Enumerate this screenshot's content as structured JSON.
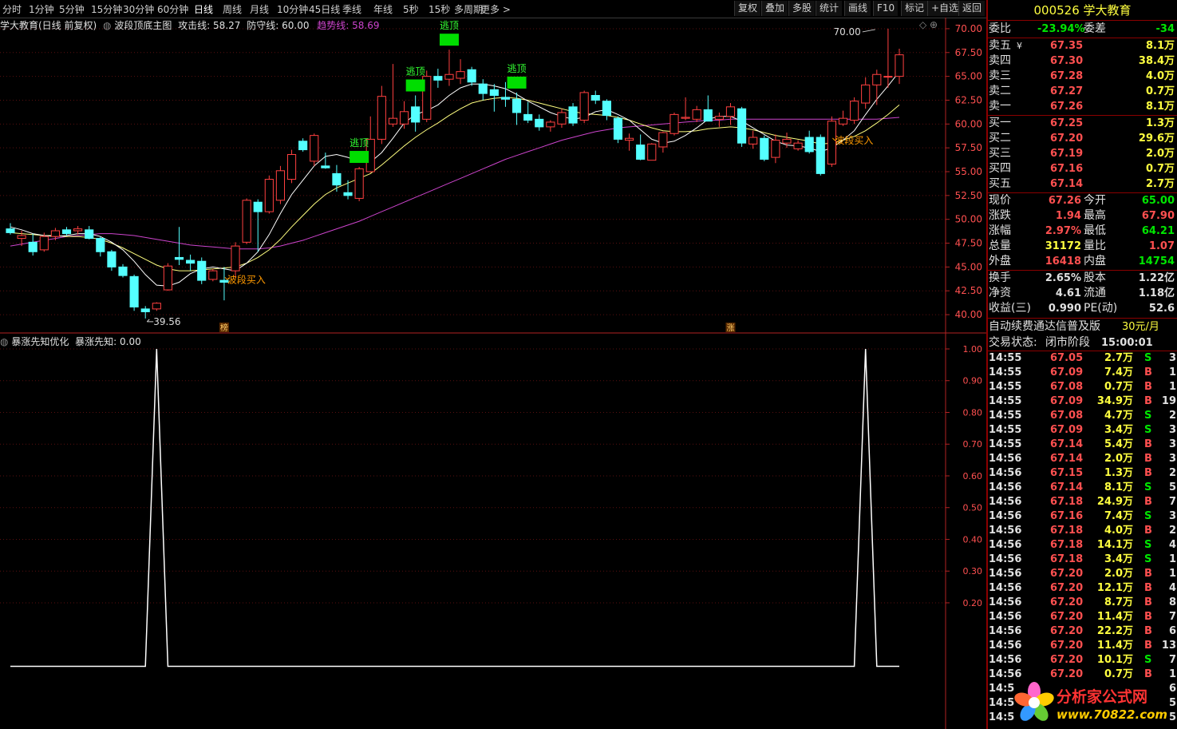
{
  "toolbar": {
    "periods": [
      "分时",
      "1分钟",
      "5分钟",
      "15分钟",
      "30分钟",
      "60分钟",
      "日线",
      "周线",
      "月线",
      "10分钟",
      "45日线",
      "季线",
      "年线",
      "5秒",
      "15秒",
      "多周期",
      "更多 >"
    ],
    "right": [
      "复权",
      "叠加",
      "多股",
      "统计",
      "画线",
      "F10",
      "标记",
      "+自选",
      "返回"
    ]
  },
  "main_info": {
    "stock": "学大教育(日线 前复权)",
    "indicator": "波段顶底主图",
    "attack_label": "攻击线:",
    "attack": "58.27",
    "defense_label": "防守线:",
    "defense": "60.00",
    "trend_label": "趋势线:",
    "trend": "58.69"
  },
  "sub_info": {
    "indicator": "暴涨先知优化",
    "value_label": "暴涨先知:",
    "value": "0.00"
  },
  "markers": {
    "escape": "逃顶",
    "buy": "波段买入",
    "high": "70.00",
    "low": "39.56",
    "bang": "榜",
    "zhang": "涨"
  },
  "colors": {
    "up": "#ff4040",
    "down": "#54ffff",
    "ma_fast": "#ffffff",
    "ma_slow": "#ffff80",
    "ma_trend": "#cc44cc",
    "escape": "#00dd00",
    "buy": "#ff9900",
    "axis": "#b22222"
  },
  "chart_data": [
    {
      "type": "candlestick",
      "title": "学大教育(日线 前复权)",
      "y_ticks": [
        40.0,
        42.5,
        45.0,
        47.5,
        50.0,
        52.5,
        55.0,
        57.5,
        60.0,
        62.5,
        65.0,
        67.5,
        70.0
      ],
      "ylim": [
        39.0,
        71.0
      ],
      "ohlc": [
        [
          49.0,
          49.6,
          48.4,
          48.6
        ],
        [
          48.0,
          48.8,
          47.2,
          48.3
        ],
        [
          47.6,
          48.5,
          46.2,
          46.6
        ],
        [
          46.8,
          48.6,
          46.6,
          48.2
        ],
        [
          48.2,
          49.1,
          47.8,
          48.8
        ],
        [
          48.9,
          49.2,
          48.3,
          48.5
        ],
        [
          48.8,
          49.3,
          48.4,
          49.0
        ],
        [
          48.9,
          49.3,
          47.9,
          48.0
        ],
        [
          48.0,
          48.2,
          46.1,
          46.6
        ],
        [
          46.6,
          46.8,
          44.6,
          45.0
        ],
        [
          45.0,
          45.3,
          43.9,
          44.1
        ],
        [
          44.0,
          44.2,
          40.4,
          40.8
        ],
        [
          40.6,
          40.9,
          39.6,
          40.3
        ],
        [
          40.6,
          41.3,
          40.4,
          41.2
        ],
        [
          42.6,
          45.4,
          42.5,
          45.1
        ],
        [
          46.0,
          49.2,
          45.2,
          45.8
        ],
        [
          45.7,
          46.3,
          44.6,
          45.4
        ],
        [
          45.6,
          46.0,
          43.2,
          43.6
        ],
        [
          43.7,
          44.8,
          43.5,
          44.6
        ],
        [
          43.6,
          45.0,
          41.5,
          43.4
        ],
        [
          44.6,
          47.6,
          43.8,
          47.2
        ],
        [
          47.6,
          52.2,
          47.4,
          52.0
        ],
        [
          51.8,
          52.1,
          46.6,
          50.8
        ],
        [
          50.8,
          54.6,
          50.6,
          54.2
        ],
        [
          52.0,
          55.6,
          51.6,
          55.1
        ],
        [
          54.2,
          57.3,
          53.8,
          56.8
        ],
        [
          58.2,
          58.5,
          57.1,
          57.3
        ],
        [
          56.1,
          59.0,
          55.6,
          58.8
        ],
        [
          55.6,
          57.0,
          55.3,
          55.4
        ],
        [
          54.8,
          55.7,
          52.9,
          53.6
        ],
        [
          52.8,
          54.1,
          52.1,
          52.5
        ],
        [
          52.2,
          55.5,
          51.9,
          55.3
        ],
        [
          55.0,
          60.8,
          54.9,
          58.4
        ],
        [
          58.4,
          64.0,
          57.9,
          62.9
        ],
        [
          60.0,
          66.3,
          59.7,
          60.6
        ],
        [
          60.0,
          62.4,
          59.5,
          61.3
        ],
        [
          61.8,
          63.0,
          59.2,
          60.2
        ],
        [
          60.5,
          65.6,
          60.2,
          65.0
        ],
        [
          65.0,
          65.8,
          63.8,
          64.6
        ],
        [
          64.7,
          67.8,
          64.0,
          65.2
        ],
        [
          64.8,
          66.8,
          64.2,
          65.5
        ],
        [
          65.7,
          66.0,
          64.0,
          64.4
        ],
        [
          64.2,
          64.7,
          62.5,
          63.2
        ],
        [
          63.6,
          64.2,
          61.3,
          63.0
        ],
        [
          62.8,
          64.4,
          61.8,
          62.6
        ],
        [
          62.6,
          63.3,
          59.9,
          61.2
        ],
        [
          61.0,
          62.3,
          60.1,
          60.4
        ],
        [
          60.5,
          61.0,
          59.3,
          59.7
        ],
        [
          59.7,
          60.4,
          59.2,
          60.2
        ],
        [
          60.0,
          61.6,
          59.6,
          61.2
        ],
        [
          61.8,
          62.2,
          59.8,
          60.1
        ],
        [
          60.4,
          63.5,
          60.1,
          63.3
        ],
        [
          63.0,
          63.5,
          62.1,
          62.5
        ],
        [
          62.4,
          62.6,
          60.4,
          60.9
        ],
        [
          60.6,
          60.8,
          58.0,
          58.4
        ],
        [
          58.3,
          59.0,
          57.2,
          58.5
        ],
        [
          57.8,
          58.9,
          56.2,
          56.3
        ],
        [
          56.2,
          58.0,
          56.2,
          57.9
        ],
        [
          57.6,
          59.2,
          57.0,
          59.1
        ],
        [
          59.0,
          61.2,
          58.8,
          61.0
        ],
        [
          60.6,
          62.8,
          60.4,
          60.7
        ],
        [
          60.5,
          61.9,
          60.2,
          61.5
        ],
        [
          61.5,
          63.0,
          60.4,
          60.3
        ],
        [
          60.5,
          61.2,
          59.7,
          60.8
        ],
        [
          60.8,
          62.2,
          59.9,
          61.8
        ],
        [
          61.6,
          61.8,
          57.6,
          58.0
        ],
        [
          57.9,
          59.3,
          57.4,
          58.6
        ],
        [
          58.5,
          58.8,
          56.1,
          56.3
        ],
        [
          56.5,
          58.9,
          55.9,
          58.3
        ],
        [
          58.0,
          59.1,
          57.5,
          58.4
        ],
        [
          57.4,
          58.3,
          57.2,
          58.0
        ],
        [
          58.6,
          59.3,
          56.9,
          57.1
        ],
        [
          58.6,
          58.9,
          54.6,
          54.8
        ],
        [
          55.8,
          60.8,
          55.5,
          60.3
        ],
        [
          60.0,
          61.4,
          59.8,
          60.6
        ],
        [
          60.4,
          62.8,
          60.0,
          62.4
        ],
        [
          62.2,
          64.9,
          61.6,
          64.1
        ],
        [
          64.1,
          65.7,
          62.0,
          65.2
        ],
        [
          65.0,
          70.0,
          63.8,
          65.0
        ],
        [
          65.0,
          67.9,
          64.2,
          67.26
        ]
      ],
      "ma_fast": [
        49.2,
        48.9,
        48.5,
        48.3,
        48.2,
        48.3,
        48.5,
        48.5,
        48.2,
        47.6,
        46.8,
        45.6,
        44.2,
        43.1,
        43.0,
        43.4,
        44.3,
        44.8,
        45.0,
        44.8,
        44.6,
        45.4,
        46.6,
        48.4,
        50.6,
        52.6,
        54.1,
        55.6,
        56.6,
        56.8,
        56.5,
        56.0,
        56.0,
        57.0,
        58.5,
        60.1,
        61.0,
        61.4,
        62.0,
        63.0,
        63.8,
        64.2,
        64.2,
        64.0,
        63.7,
        63.1,
        62.4,
        61.8,
        61.2,
        60.8,
        60.5,
        60.7,
        61.3,
        61.5,
        61.0,
        60.4,
        59.4,
        58.4,
        58.0,
        58.2,
        58.8,
        59.6,
        60.5,
        60.8,
        60.8,
        60.3,
        59.6,
        58.9,
        58.2,
        57.8,
        57.7,
        57.5,
        57.1,
        57.5,
        58.3,
        59.3,
        61.0,
        62.6,
        64.0,
        65.5
      ],
      "ma_slow": [
        48.6,
        48.5,
        48.4,
        48.3,
        48.3,
        48.2,
        48.2,
        48.1,
        47.9,
        47.5,
        47.0,
        46.4,
        45.8,
        45.2,
        44.8,
        44.6,
        44.6,
        44.7,
        44.8,
        44.9,
        45.0,
        45.4,
        46.0,
        46.8,
        47.9,
        49.2,
        50.4,
        51.6,
        52.6,
        53.3,
        53.8,
        54.3,
        54.8,
        55.7,
        56.7,
        57.7,
        58.6,
        59.4,
        60.1,
        60.9,
        61.6,
        62.2,
        62.5,
        62.7,
        62.8,
        62.7,
        62.5,
        62.2,
        61.9,
        61.6,
        61.3,
        61.1,
        61.0,
        60.9,
        60.7,
        60.4,
        60.0,
        59.6,
        59.3,
        59.2,
        59.2,
        59.3,
        59.5,
        59.6,
        59.7,
        59.6,
        59.4,
        59.1,
        58.8,
        58.6,
        58.4,
        58.2,
        57.9,
        58.0,
        58.3,
        58.7,
        59.3,
        60.1,
        61.0,
        62.0
      ],
      "ma_trend": [
        47.2,
        47.4,
        47.6,
        47.8,
        48.0,
        48.2,
        48.3,
        48.4,
        48.5,
        48.5,
        48.4,
        48.3,
        48.1,
        47.9,
        47.7,
        47.5,
        47.3,
        47.2,
        47.1,
        47.0,
        46.9,
        46.9,
        46.9,
        47.0,
        47.2,
        47.5,
        47.8,
        48.2,
        48.6,
        49.0,
        49.4,
        49.8,
        50.3,
        50.8,
        51.3,
        51.8,
        52.3,
        52.8,
        53.3,
        53.8,
        54.3,
        54.8,
        55.3,
        55.8,
        56.3,
        56.7,
        57.1,
        57.5,
        57.9,
        58.3,
        58.6,
        58.9,
        59.2,
        59.4,
        59.6,
        59.7,
        59.8,
        59.9,
        60.0,
        60.1,
        60.2,
        60.3,
        60.4,
        60.4,
        60.5,
        60.5,
        60.5,
        60.5,
        60.5,
        60.5,
        60.5,
        60.5,
        60.5,
        60.5,
        60.5,
        60.5,
        60.5,
        60.5,
        60.6,
        60.7
      ]
    },
    {
      "type": "line",
      "title": "暴涨先知优化",
      "y_ticks": [
        0.2,
        0.3,
        0.4,
        0.5,
        0.6,
        0.7,
        0.8,
        0.9,
        1.0
      ],
      "ylim": [
        -0.18,
        1.0
      ],
      "series": [
        {
          "name": "暴涨先知",
          "spikes_at_bar": [
            13,
            76
          ],
          "values_note": "0 except 1.00 at spike bars",
          "x": [
            0,
            12,
            13,
            14,
            75,
            76,
            77,
            79
          ],
          "y": [
            0,
            0,
            1,
            0,
            0,
            1,
            0,
            0
          ]
        }
      ]
    }
  ],
  "quote": {
    "title": "000526 学大教育",
    "weibi_label": "委比",
    "weibi": "-23.94%",
    "weicha_label": "委差",
    "weicha": "-34",
    "asks": [
      {
        "label": "卖五",
        "mark": "¥",
        "price": "67.35",
        "vol": "8.1万"
      },
      {
        "label": "卖四",
        "mark": "",
        "price": "67.30",
        "vol": "38.4万"
      },
      {
        "label": "卖三",
        "mark": "",
        "price": "67.28",
        "vol": "4.0万"
      },
      {
        "label": "卖二",
        "mark": "",
        "price": "67.27",
        "vol": "0.7万"
      },
      {
        "label": "卖一",
        "mark": "",
        "price": "67.26",
        "vol": "8.1万"
      }
    ],
    "bids": [
      {
        "label": "买一",
        "price": "67.25",
        "vol": "1.3万"
      },
      {
        "label": "买二",
        "price": "67.20",
        "vol": "29.6万"
      },
      {
        "label": "买三",
        "price": "67.19",
        "vol": "2.0万"
      },
      {
        "label": "买四",
        "price": "67.16",
        "vol": "0.7万"
      },
      {
        "label": "买五",
        "price": "67.14",
        "vol": "2.7万"
      }
    ],
    "stats": [
      {
        "l1": "现价",
        "v1": "67.26",
        "c1": "red",
        "l2": "今开",
        "v2": "65.00",
        "c2": "grn"
      },
      {
        "l1": "涨跌",
        "v1": "1.94",
        "c1": "red",
        "l2": "最高",
        "v2": "67.90",
        "c2": "red"
      },
      {
        "l1": "涨幅",
        "v1": "2.97%",
        "c1": "red",
        "l2": "最低",
        "v2": "64.21",
        "c2": "grn"
      },
      {
        "l1": "总量",
        "v1": "31172",
        "c1": "yel",
        "l2": "量比",
        "v2": "1.07",
        "c2": "red"
      },
      {
        "l1": "外盘",
        "v1": "16418",
        "c1": "red",
        "l2": "内盘",
        "v2": "14754",
        "c2": "grn"
      }
    ],
    "stats2": [
      {
        "l1": "换手",
        "v1": "2.65%",
        "l2": "股本",
        "v2": "1.22亿"
      },
      {
        "l1": "净资",
        "v1": "4.61",
        "l2": "流通",
        "v2": "1.18亿"
      },
      {
        "l1": "收益(三)",
        "v1": "0.990",
        "l2": "PE(动)",
        "v2": "52.6"
      }
    ],
    "notice": "自动续费通达信普及版",
    "notice_price": "30元/月",
    "status_label": "交易状态:",
    "status": "闭市阶段",
    "status_time": "15:00:01"
  },
  "ticks": [
    [
      "14:55",
      "67.05",
      "2.7万",
      "S",
      "3"
    ],
    [
      "14:55",
      "67.09",
      "7.4万",
      "B",
      "1"
    ],
    [
      "14:55",
      "67.08",
      "0.7万",
      "B",
      "1"
    ],
    [
      "14:55",
      "67.09",
      "34.9万",
      "B",
      "19"
    ],
    [
      "14:55",
      "67.08",
      "4.7万",
      "S",
      "2"
    ],
    [
      "14:55",
      "67.09",
      "3.4万",
      "S",
      "3"
    ],
    [
      "14:55",
      "67.14",
      "5.4万",
      "B",
      "3"
    ],
    [
      "14:56",
      "67.14",
      "2.0万",
      "B",
      "3"
    ],
    [
      "14:56",
      "67.15",
      "1.3万",
      "B",
      "2"
    ],
    [
      "14:56",
      "67.14",
      "8.1万",
      "S",
      "5"
    ],
    [
      "14:56",
      "67.18",
      "24.9万",
      "B",
      "7"
    ],
    [
      "14:56",
      "67.16",
      "7.4万",
      "S",
      "3"
    ],
    [
      "14:56",
      "67.18",
      "4.0万",
      "B",
      "2"
    ],
    [
      "14:56",
      "67.18",
      "14.1万",
      "S",
      "4"
    ],
    [
      "14:56",
      "67.18",
      "3.4万",
      "S",
      "1"
    ],
    [
      "14:56",
      "67.20",
      "2.0万",
      "B",
      "1"
    ],
    [
      "14:56",
      "67.20",
      "12.1万",
      "B",
      "4"
    ],
    [
      "14:56",
      "67.20",
      "8.7万",
      "B",
      "8"
    ],
    [
      "14:56",
      "67.20",
      "11.4万",
      "B",
      "7"
    ],
    [
      "14:56",
      "67.20",
      "22.2万",
      "B",
      "6"
    ],
    [
      "14:56",
      "67.20",
      "11.4万",
      "B",
      "13"
    ],
    [
      "14:56",
      "67.20",
      "10.1万",
      "S",
      "7"
    ],
    [
      "14:56",
      "67.20",
      "0.7万",
      "B",
      "1"
    ],
    [
      "14:5",
      "",
      "",
      "",
      "6"
    ],
    [
      "14:5",
      "",
      "",
      "",
      "5"
    ],
    [
      "14:5",
      "",
      "",
      "",
      "5"
    ]
  ],
  "watermark": {
    "name": "分析家公式网",
    "url": "www.70822.com"
  }
}
